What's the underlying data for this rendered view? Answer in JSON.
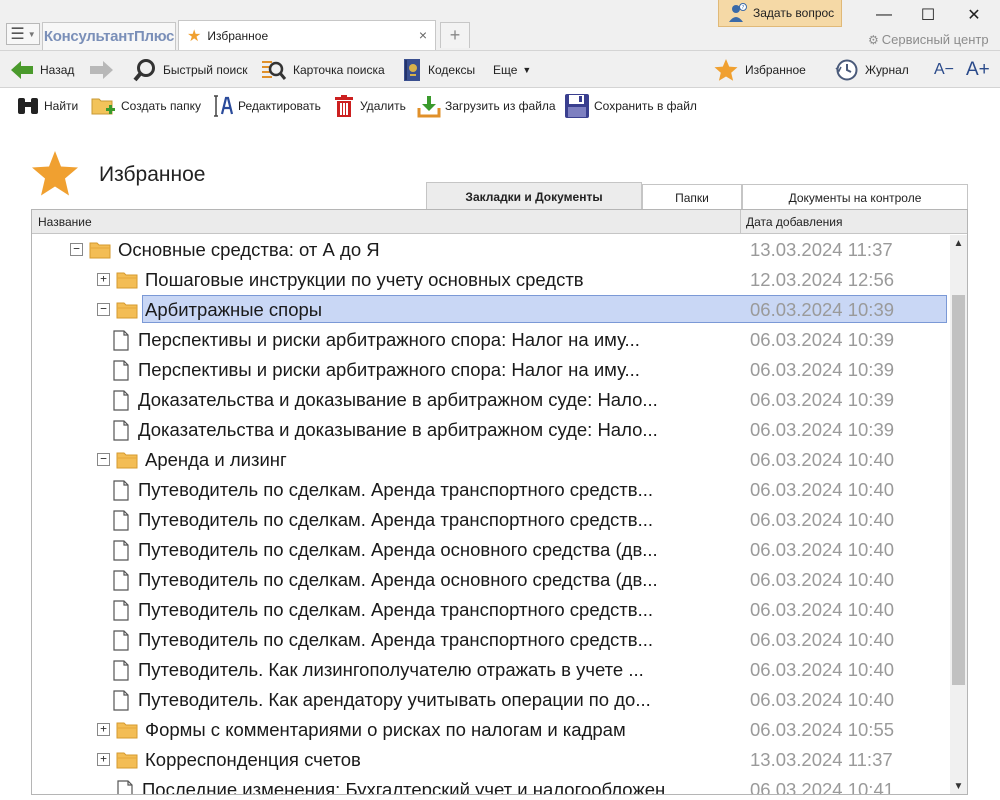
{
  "titlebar": {
    "logo_text": "КонсультантПлюс",
    "doc_tab_label": "Избранное",
    "ask_button_label": "Задать вопрос",
    "service_center_label": "Сервисный центр"
  },
  "toolbar1": {
    "back_label": "Назад",
    "quick_search_label": "Быстрый поиск",
    "search_card_label": "Карточка поиска",
    "codes_label": "Кодексы",
    "more_label": "Еще",
    "favorites_label": "Избранное",
    "journal_label": "Журнал",
    "font_decrease_label": "A−",
    "font_increase_label": "A+"
  },
  "toolbar2": {
    "find_label": "Найти",
    "create_folder_label": "Создать папку",
    "edit_label": "Редактировать",
    "delete_label": "Удалить",
    "load_from_file_label": "Загрузить из файла",
    "save_to_file_label": "Сохранить в файл"
  },
  "page": {
    "title": "Избранное"
  },
  "tabs": [
    {
      "label": "Закладки и Документы",
      "active": true
    },
    {
      "label": "Папки",
      "active": false
    },
    {
      "label": "Документы на контроле",
      "active": false
    }
  ],
  "table": {
    "col_name": "Название",
    "col_date": "Дата добавления",
    "rows": [
      {
        "type": "folder",
        "level": 0,
        "toggle": "−",
        "title": "Основные средства: от А до Я",
        "date": "13.03.2024 11:37"
      },
      {
        "type": "folder",
        "level": 1,
        "toggle": "+",
        "title": "Пошаговые инструкции по учету основных средств",
        "date": "12.03.2024 12:56"
      },
      {
        "type": "folder",
        "level": 1,
        "toggle": "−",
        "title": "Арбитражные споры",
        "date": "06.03.2024 10:39",
        "selected": true
      },
      {
        "type": "doc",
        "level": 2,
        "title": "Перспективы и риски арбитражного спора: Налог на иму...",
        "date": "06.03.2024 10:39"
      },
      {
        "type": "doc",
        "level": 2,
        "title": "Перспективы и риски арбитражного спора: Налог на иму...",
        "date": "06.03.2024 10:39"
      },
      {
        "type": "doc",
        "level": 2,
        "title": "Доказательства и доказывание в арбитражном суде: Нало...",
        "date": "06.03.2024 10:39"
      },
      {
        "type": "doc",
        "level": 2,
        "title": "Доказательства и доказывание в арбитражном суде: Нало...",
        "date": "06.03.2024 10:39"
      },
      {
        "type": "folder",
        "level": 1,
        "toggle": "−",
        "title": "Аренда и лизинг",
        "date": "06.03.2024 10:40"
      },
      {
        "type": "doc",
        "level": 2,
        "title": "Путеводитель по сделкам. Аренда транспортного средств...",
        "date": "06.03.2024 10:40"
      },
      {
        "type": "doc",
        "level": 2,
        "title": "Путеводитель по сделкам. Аренда транспортного средств...",
        "date": "06.03.2024 10:40"
      },
      {
        "type": "doc",
        "level": 2,
        "title": "Путеводитель по сделкам. Аренда основного средства (дв...",
        "date": "06.03.2024 10:40"
      },
      {
        "type": "doc",
        "level": 2,
        "title": "Путеводитель по сделкам. Аренда основного средства (дв...",
        "date": "06.03.2024 10:40"
      },
      {
        "type": "doc",
        "level": 2,
        "title": "Путеводитель по сделкам. Аренда транспортного средств...",
        "date": "06.03.2024 10:40"
      },
      {
        "type": "doc",
        "level": 2,
        "title": "Путеводитель по сделкам. Аренда транспортного средств...",
        "date": "06.03.2024 10:40"
      },
      {
        "type": "doc",
        "level": 2,
        "title": "Путеводитель. Как лизингополучателю отражать в учете ...",
        "date": "06.03.2024 10:40"
      },
      {
        "type": "doc",
        "level": 2,
        "title": "Путеводитель. Как арендатору учитывать операции по до...",
        "date": "06.03.2024 10:40"
      },
      {
        "type": "folder",
        "level": 1,
        "toggle": "+",
        "title": "Формы с комментариями о рисках по налогам и кадрам",
        "date": "06.03.2024 10:55"
      },
      {
        "type": "folder",
        "level": 1,
        "toggle": "+",
        "title": "Корреспонденция счетов",
        "date": "13.03.2024 11:37"
      },
      {
        "type": "doc",
        "level": 1,
        "title": "Последние изменения: Бухгалтерский учет и налогообложен...",
        "date": "06.03.2024 10:41"
      }
    ]
  }
}
